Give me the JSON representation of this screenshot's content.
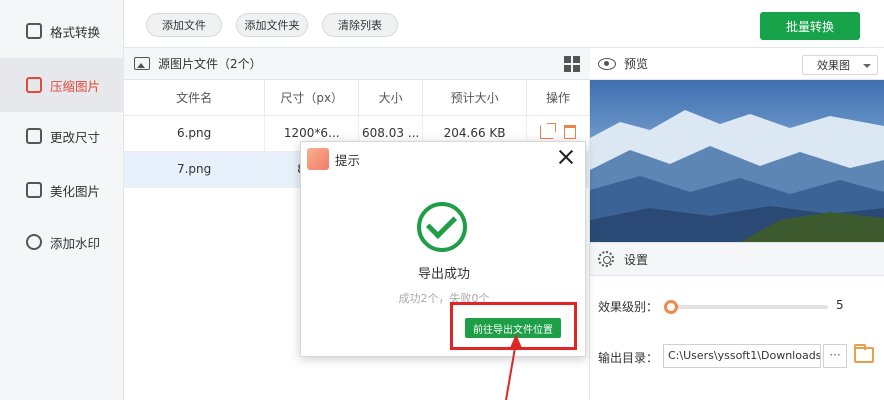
{
  "sidebar": {
    "items": [
      {
        "label": "格式转换",
        "icon": "format-convert-icon"
      },
      {
        "label": "压缩图片",
        "icon": "compress-icon",
        "active": true
      },
      {
        "label": "更改尺寸",
        "icon": "resize-icon"
      },
      {
        "label": "美化图片",
        "icon": "beautify-icon"
      },
      {
        "label": "添加水印",
        "icon": "watermark-icon"
      }
    ]
  },
  "toolbar": {
    "add_file": "添加文件",
    "add_folder": "添加文件夹",
    "clear_list": "清除列表",
    "batch_convert": "批量转换"
  },
  "source_panel": {
    "title": "源图片文件（2个）",
    "columns": [
      "文件名",
      "尺寸（px）",
      "大小",
      "预计大小",
      "操作"
    ],
    "rows": [
      {
        "name": "6.png",
        "dimensions": "1200*6...",
        "size": "608.03 ...",
        "estimated": "204.66 KB"
      },
      {
        "name": "7.png",
        "dimensions": "889*",
        "size": "",
        "estimated": ""
      }
    ]
  },
  "preview_panel": {
    "title": "预览",
    "mode": "效果图"
  },
  "settings": {
    "title": "设置",
    "effect_level_label": "效果级别：",
    "effect_level_value": "5",
    "output_dir_label": "输出目录：",
    "output_dir_value": "C:\\Users\\yssoft1\\Downloads",
    "browse_label": "···"
  },
  "dialog": {
    "title": "提示",
    "message": "导出成功",
    "detail": "成功2个，失败0个",
    "go_button": "前往导出文件位置"
  },
  "colors": {
    "accent_green": "#16a34a",
    "active_red": "#e24a3a",
    "action_orange": "#e8834a",
    "highlight_red": "#e02525"
  }
}
